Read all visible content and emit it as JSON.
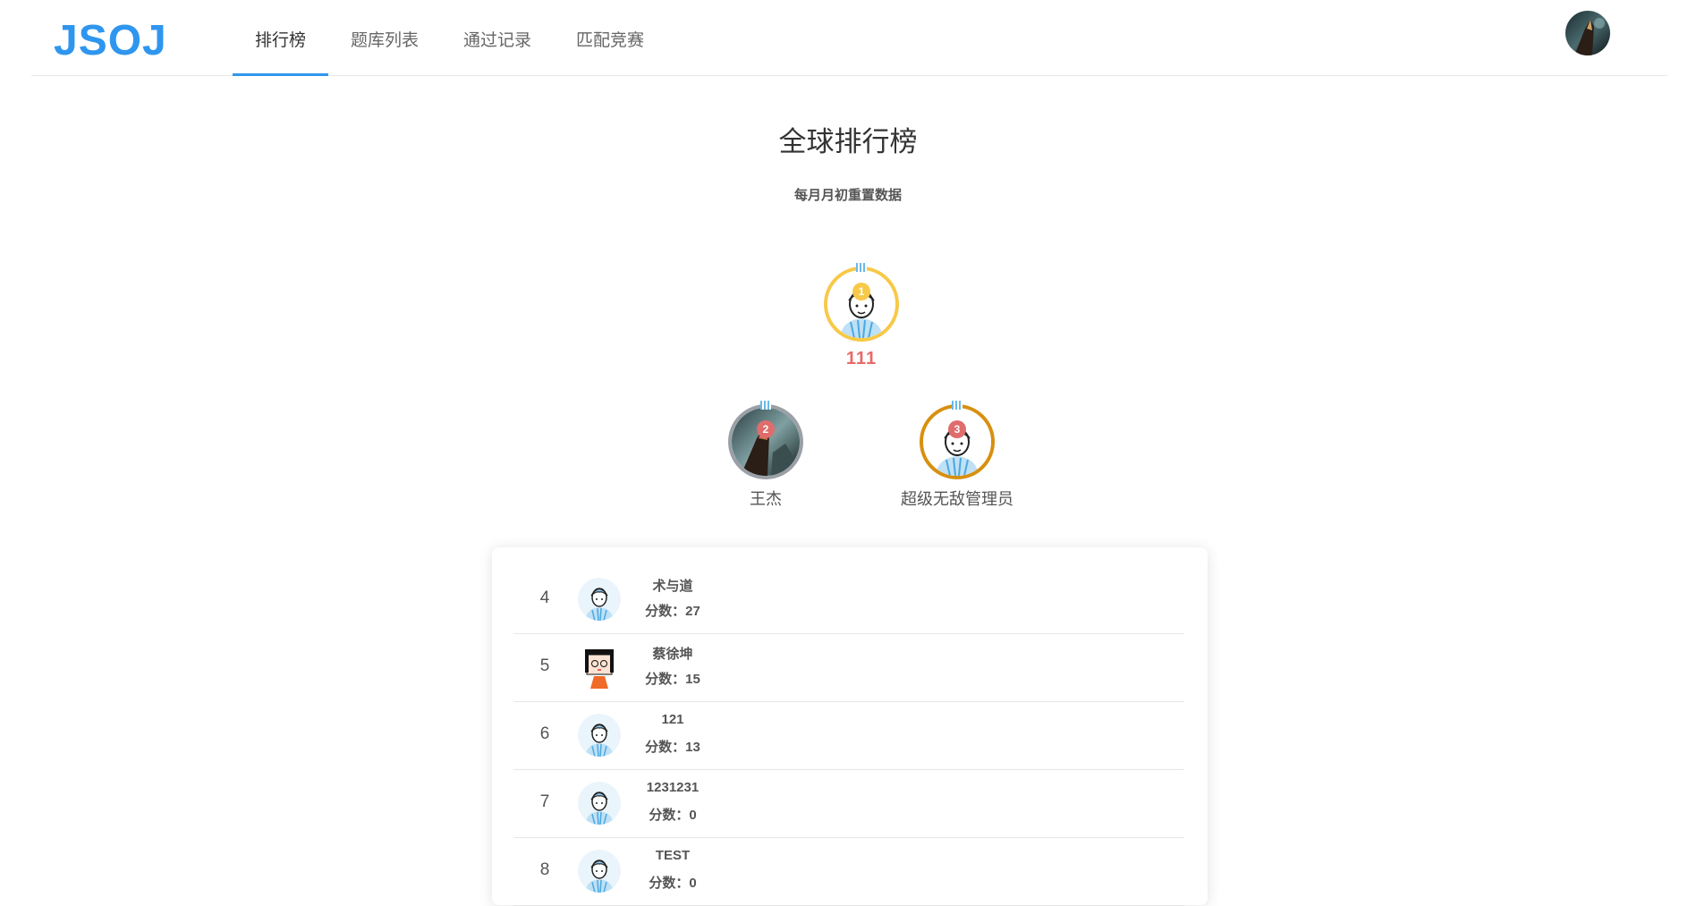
{
  "app": {
    "logo": "JSOJ"
  },
  "nav": {
    "items": [
      {
        "label": "排行榜",
        "active": true
      },
      {
        "label": "题库列表",
        "active": false
      },
      {
        "label": "通过记录",
        "active": false
      },
      {
        "label": "匹配竞赛",
        "active": false
      }
    ]
  },
  "page": {
    "title": "全球排行榜",
    "subtitle": "每月月初重置数据"
  },
  "podium": {
    "first": {
      "rank": "1",
      "label": "111"
    },
    "second": {
      "rank": "2",
      "label": "王杰"
    },
    "third": {
      "rank": "3",
      "label": "超级无敌管理员"
    }
  },
  "ranking": {
    "score_prefix": "分数：",
    "rows": [
      {
        "rank": "4",
        "name": "术与道",
        "score": "分数：27",
        "avatar": "cartoon-avatar-icon"
      },
      {
        "rank": "5",
        "name": "蔡徐坤",
        "score": "分数：15",
        "avatar": "girl-avatar-icon"
      },
      {
        "rank": "6",
        "name": "121",
        "score": "分数：13",
        "avatar": "cartoon-avatar-icon"
      },
      {
        "rank": "7",
        "name": "1231231",
        "score": "分数：0",
        "avatar": "cartoon-avatar-icon"
      },
      {
        "rank": "8",
        "name": "TEST",
        "score": "分数：0",
        "avatar": "cartoon-avatar-icon"
      }
    ]
  },
  "colors": {
    "accent": "#2f96ef",
    "gold": "#f7c948",
    "silver": "#9aa0a6",
    "bronze": "#d7900f",
    "score_red": "#e86a6a"
  }
}
